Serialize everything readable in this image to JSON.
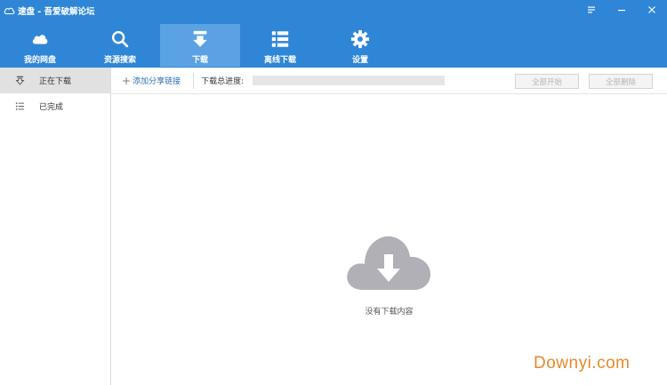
{
  "window": {
    "title": "速盘 - 吾爱破解论坛",
    "controls": [
      "menu-icon",
      "minimize-icon",
      "close-icon"
    ]
  },
  "nav": {
    "items": [
      {
        "label": "我的网盘",
        "icon": "cloud-icon",
        "active": false
      },
      {
        "label": "资源搜索",
        "icon": "search-icon",
        "active": false
      },
      {
        "label": "下载",
        "icon": "download-arrow-icon",
        "active": true
      },
      {
        "label": "离线下载",
        "icon": "list-icon",
        "active": false
      },
      {
        "label": "设置",
        "icon": "gear-icon",
        "active": false
      }
    ]
  },
  "sidebar": {
    "items": [
      {
        "label": "正在下载",
        "icon": "downloading-icon",
        "active": true
      },
      {
        "label": "已完成",
        "icon": "completed-list-icon",
        "active": false
      }
    ]
  },
  "toolbar": {
    "add_link": "添加分享链接",
    "progress_label": "下载总进度:",
    "progress": 0,
    "start_all": "全部开始",
    "delete_all": "全部删除"
  },
  "empty_state": {
    "text": "没有下载内容"
  },
  "watermark": "Downyi.com",
  "colors": {
    "accent": "#2f86d6",
    "nav_active": "#5aa2e3",
    "empty_icon": "#b0b0b6",
    "watermark": "#e8892a"
  }
}
